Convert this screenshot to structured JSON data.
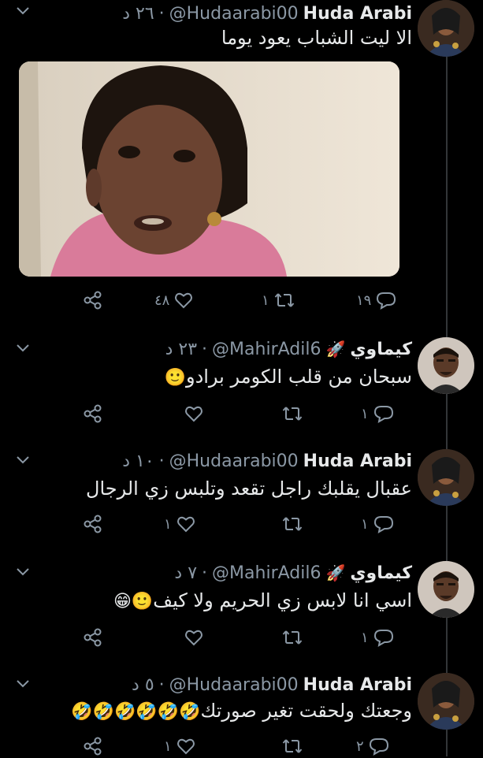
{
  "tweets": [
    {
      "name": "Huda Arabi",
      "handle": "@Hudaarabi00",
      "time": "٢٦ د",
      "text": "الا ليت الشباب يعود يوما",
      "has_media": true,
      "replies": "١٩",
      "retweets": "١",
      "likes": "٤٨"
    },
    {
      "name": "كيماوي",
      "handle": "@MahirAdil6",
      "time": "٢٣ د",
      "text": "سبحان من قلب الكومر برادو",
      "emoji": "🙂",
      "replies": "١",
      "retweets": "",
      "likes": ""
    },
    {
      "name": "Huda Arabi",
      "handle": "@Hudaarabi00",
      "time": "١٠ د",
      "text": "عقبال يقلبك راجل تقعد وتلبس زي الرجال",
      "replies": "١",
      "retweets": "",
      "likes": "١"
    },
    {
      "name": "كيماوي",
      "handle": "@MahirAdil6",
      "time": "٧ د",
      "text": "اسي انا لابس زي الحريم ولا كيف",
      "emoji": "🙂😁",
      "replies": "١",
      "retweets": "",
      "likes": ""
    },
    {
      "name": "Huda Arabi",
      "handle": "@Hudaarabi00",
      "time": "٥ د",
      "text": "وجعتك ولحقت تغير صورتك",
      "emoji": "🤣🤣🤣🤣🤣🤣",
      "replies": "٢",
      "retweets": "",
      "likes": "١"
    }
  ],
  "separator": "·",
  "icons": {
    "reply": "reply-icon",
    "retweet": "retweet-icon",
    "like": "heart-icon",
    "share": "share-icon",
    "more": "chevron-down-icon",
    "rocket": "rocket-emoji"
  },
  "rocket_emoji": "🚀",
  "colors": {
    "bg": "#000000",
    "text": "#e7e9ea",
    "muted": "#8b98a5",
    "line": "#333639"
  }
}
